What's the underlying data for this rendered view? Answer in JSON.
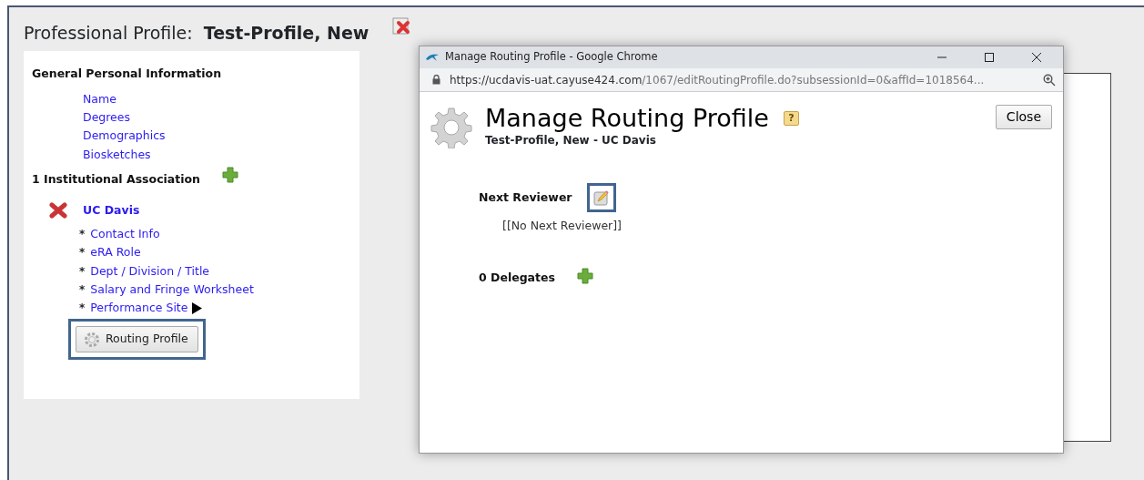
{
  "page": {
    "title_label": "Professional Profile:",
    "title_name": "Test-Profile, New"
  },
  "general": {
    "heading": "General Personal Information",
    "links": [
      "Name",
      "Degrees",
      "Demographics",
      "Biosketches"
    ]
  },
  "association": {
    "heading": "1 Institutional Association",
    "name": "UC Davis",
    "links": [
      {
        "bullet": "*",
        "label": "Contact Info",
        "expandable": false
      },
      {
        "bullet": "*",
        "label": "eRA Role",
        "expandable": false
      },
      {
        "bullet": "*",
        "label": "Dept / Division / Title",
        "expandable": false
      },
      {
        "bullet": "*",
        "label": "Salary and Fringe Worksheet",
        "expandable": false
      },
      {
        "bullet": "*",
        "label": "Performance Site",
        "expandable": true
      }
    ],
    "routing_button": "Routing Profile"
  },
  "popup": {
    "window_title": "Manage Routing Profile - Google Chrome",
    "url_host": "https://ucdavis-uat.cayuse424.com",
    "url_path": "/1067/editRoutingProfile.do?subsessionId=0&affId=1018564...",
    "heading": "Manage Routing Profile",
    "help": "?",
    "subheading": "Test-Profile, New - UC Davis",
    "close_button": "Close",
    "next_reviewer_label": "Next Reviewer",
    "next_reviewer_value": "[[No Next Reviewer]]",
    "delegates_label": "0 Delegates"
  }
}
